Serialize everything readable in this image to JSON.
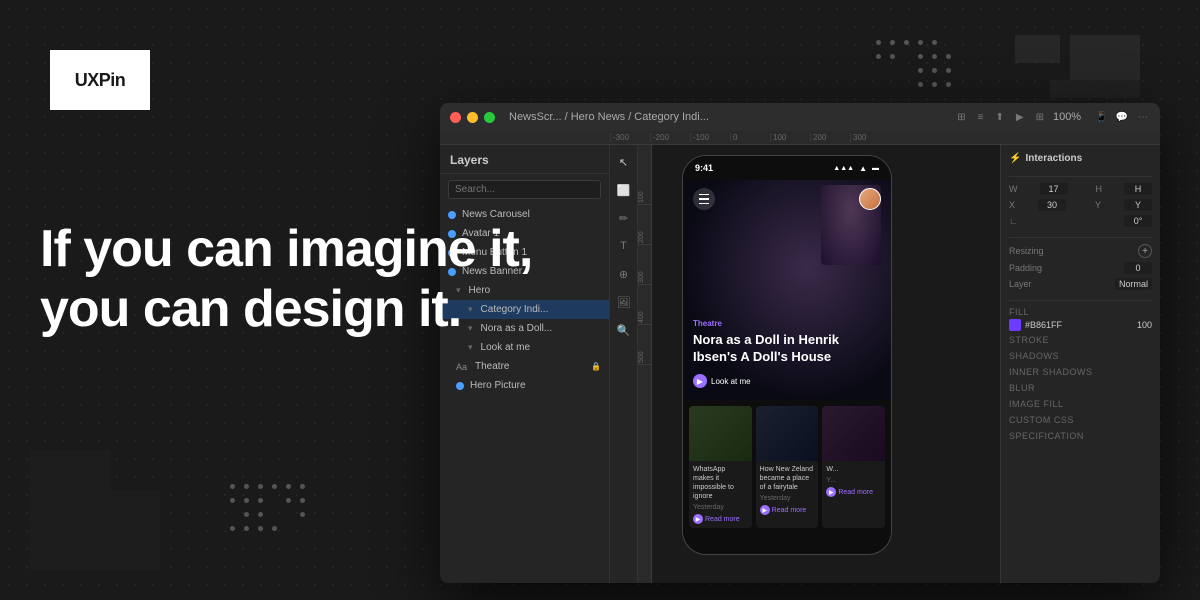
{
  "brand": {
    "name": "UXPin"
  },
  "headline": {
    "line1": "If you can imagine it,",
    "line2": "you can design it."
  },
  "app": {
    "title_bar": {
      "breadcrumb": "NewsScr... / Hero News / Category Indi...",
      "zoom": "100%"
    },
    "layers_panel": {
      "header": "Layers",
      "search_placeholder": "Search...",
      "items": [
        {
          "label": "News Carousel",
          "type": "component",
          "color": "blue"
        },
        {
          "label": "Avatar 1",
          "type": "component",
          "color": "blue"
        },
        {
          "label": "Menu Button 1",
          "type": "component",
          "color": "blue"
        },
        {
          "label": "News Banner",
          "type": "component",
          "color": "blue"
        },
        {
          "label": "Hero",
          "type": "group",
          "indent": 1
        },
        {
          "label": "Category Indi...",
          "type": "group",
          "indent": 2
        },
        {
          "label": "Nora as a Doll...",
          "type": "group",
          "indent": 2
        },
        {
          "label": "Look at me",
          "type": "group",
          "indent": 2
        },
        {
          "label": "Theatre",
          "type": "text",
          "indent": 1
        },
        {
          "label": "Hero Picture",
          "type": "image",
          "color": "blue",
          "indent": 1
        }
      ]
    },
    "phone": {
      "time": "9:41",
      "hero": {
        "category": "Theatre",
        "title": "Nora as a Doll in Henrik Ibsen's A Doll's House",
        "cta_text": "Look at me"
      },
      "cards": [
        {
          "title": "WhatsApp makes it impossible to ignore",
          "date": "Yesterday",
          "cta": "Read more"
        },
        {
          "title": "How New Zeland became a place of a fairytale",
          "date": "Yesterday",
          "cta": "Read more"
        },
        {
          "title": "W...",
          "date": "Y...",
          "cta": "Read more"
        }
      ]
    },
    "right_panel": {
      "section": "Interactions",
      "properties": {
        "w_label": "W",
        "w_value": "17",
        "h_label": "H",
        "x_label": "X",
        "x_value": "30",
        "y_label": "Y",
        "angle_label": "∟",
        "angle_value": "0°",
        "resizing_label": "Resizing",
        "padding_label": "Padding",
        "padding_value": "0",
        "layer_label": "Layer",
        "layer_value": "Normal",
        "fill_label": "FILL",
        "fill_hex": "#B861FF",
        "fill_opacity": "100",
        "stroke_label": "STROKE",
        "shadows_label": "SHADOWS",
        "inner_shadows_label": "INNER SHADOWS",
        "blur_label": "BLUR",
        "image_fill_label": "IMAGE FILL",
        "custom_css_label": "CUSTOM CSS",
        "specification_label": "SPECIFICATION"
      }
    }
  }
}
